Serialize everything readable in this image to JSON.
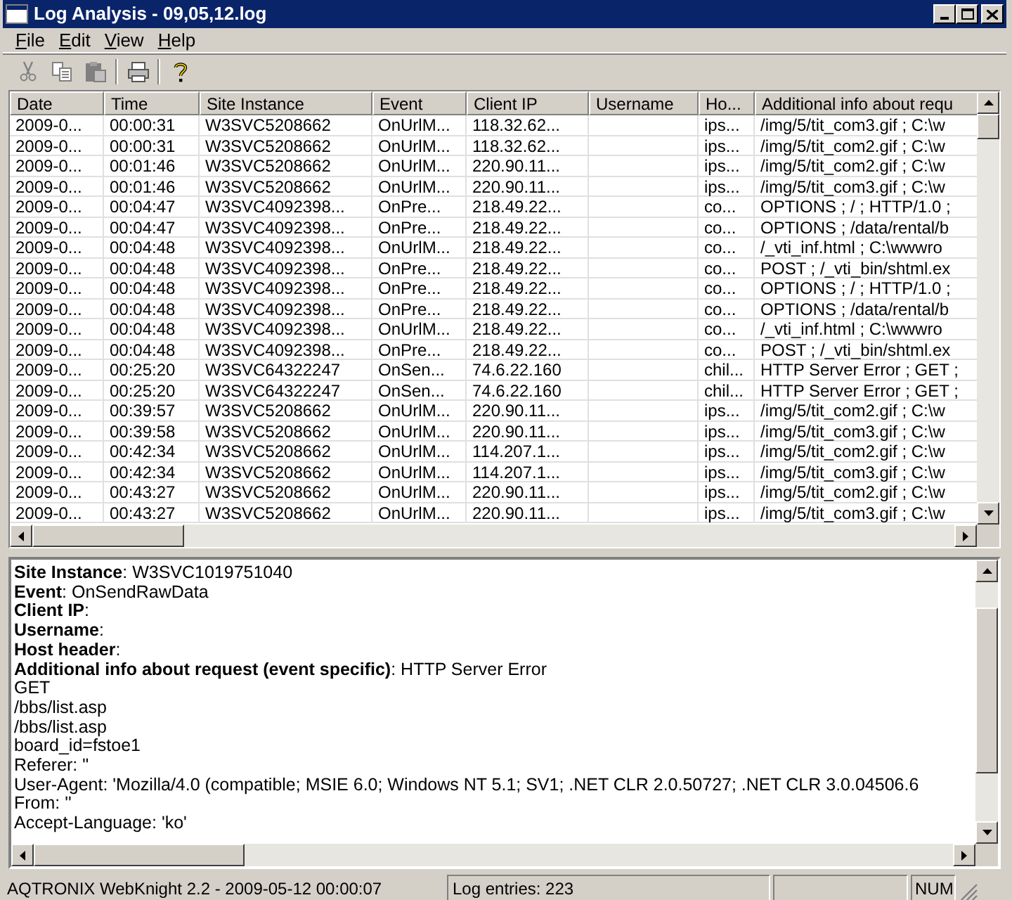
{
  "window": {
    "title": "Log Analysis - 09,05,12.log"
  },
  "menu": [
    "File",
    "Edit",
    "View",
    "Help"
  ],
  "toolbar": [
    {
      "kind": "cut"
    },
    {
      "kind": "copy"
    },
    {
      "kind": "paste"
    },
    {
      "kind": "separator"
    },
    {
      "kind": "print"
    },
    {
      "kind": "separator"
    },
    {
      "kind": "help"
    }
  ],
  "table": {
    "columns": [
      "Date",
      "Time",
      "Site Instance",
      "Event",
      "Client IP",
      "Username",
      "Ho...",
      "Additional info about requ"
    ],
    "rows": [
      {
        "date": "2009-0...",
        "time": "00:00:31",
        "site": "W3SVC5208662",
        "event": "OnUrlM...",
        "client_ip": "118.32.62...",
        "host": "ips...",
        "info": "/img/5/tit_com3.gif ; C:\\w"
      },
      {
        "date": "2009-0...",
        "time": "00:00:31",
        "site": "W3SVC5208662",
        "event": "OnUrlM...",
        "client_ip": "118.32.62...",
        "host": "ips...",
        "info": "/img/5/tit_com2.gif ; C:\\w"
      },
      {
        "date": "2009-0...",
        "time": "00:01:46",
        "site": "W3SVC5208662",
        "event": "OnUrlM...",
        "client_ip": "220.90.11...",
        "host": "ips...",
        "info": "/img/5/tit_com2.gif ; C:\\w"
      },
      {
        "date": "2009-0...",
        "time": "00:01:46",
        "site": "W3SVC5208662",
        "event": "OnUrlM...",
        "client_ip": "220.90.11...",
        "host": "ips...",
        "info": "/img/5/tit_com3.gif ; C:\\w"
      },
      {
        "date": "2009-0...",
        "time": "00:04:47",
        "site": "W3SVC4092398...",
        "event": "OnPre...",
        "client_ip": "218.49.22...",
        "host": "co...",
        "info": "OPTIONS ; / ; HTTP/1.0 ;"
      },
      {
        "date": "2009-0...",
        "time": "00:04:47",
        "site": "W3SVC4092398...",
        "event": "OnPre...",
        "client_ip": "218.49.22...",
        "host": "co...",
        "info": "OPTIONS ; /data/rental/b"
      },
      {
        "date": "2009-0...",
        "time": "00:04:48",
        "site": "W3SVC4092398...",
        "event": "OnUrlM...",
        "client_ip": "218.49.22...",
        "host": "co...",
        "info": "/_vti_inf.html ; C:\\wwwro"
      },
      {
        "date": "2009-0...",
        "time": "00:04:48",
        "site": "W3SVC4092398...",
        "event": "OnPre...",
        "client_ip": "218.49.22...",
        "host": "co...",
        "info": "POST ; /_vti_bin/shtml.ex"
      },
      {
        "date": "2009-0...",
        "time": "00:04:48",
        "site": "W3SVC4092398...",
        "event": "OnPre...",
        "client_ip": "218.49.22...",
        "host": "co...",
        "info": "OPTIONS ; / ; HTTP/1.0 ;"
      },
      {
        "date": "2009-0...",
        "time": "00:04:48",
        "site": "W3SVC4092398...",
        "event": "OnPre...",
        "client_ip": "218.49.22...",
        "host": "co...",
        "info": "OPTIONS ; /data/rental/b"
      },
      {
        "date": "2009-0...",
        "time": "00:04:48",
        "site": "W3SVC4092398...",
        "event": "OnUrlM...",
        "client_ip": "218.49.22...",
        "host": "co...",
        "info": "/_vti_inf.html ; C:\\wwwro"
      },
      {
        "date": "2009-0...",
        "time": "00:04:48",
        "site": "W3SVC4092398...",
        "event": "OnPre...",
        "client_ip": "218.49.22...",
        "host": "co...",
        "info": "POST ; /_vti_bin/shtml.ex"
      },
      {
        "date": "2009-0...",
        "time": "00:25:20",
        "site": "W3SVC64322247",
        "event": "OnSen...",
        "client_ip": "74.6.22.160",
        "host": "chil...",
        "info": "HTTP Server Error ; GET ;"
      },
      {
        "date": "2009-0...",
        "time": "00:25:20",
        "site": "W3SVC64322247",
        "event": "OnSen...",
        "client_ip": "74.6.22.160",
        "host": "chil...",
        "info": "HTTP Server Error ; GET ;"
      },
      {
        "date": "2009-0...",
        "time": "00:39:57",
        "site": "W3SVC5208662",
        "event": "OnUrlM...",
        "client_ip": "220.90.11...",
        "host": "ips...",
        "info": "/img/5/tit_com2.gif ; C:\\w"
      },
      {
        "date": "2009-0...",
        "time": "00:39:58",
        "site": "W3SVC5208662",
        "event": "OnUrlM...",
        "client_ip": "220.90.11...",
        "host": "ips...",
        "info": "/img/5/tit_com3.gif ; C:\\w"
      },
      {
        "date": "2009-0...",
        "time": "00:42:34",
        "site": "W3SVC5208662",
        "event": "OnUrlM...",
        "client_ip": "114.207.1...",
        "host": "ips...",
        "info": "/img/5/tit_com2.gif ; C:\\w"
      },
      {
        "date": "2009-0...",
        "time": "00:42:34",
        "site": "W3SVC5208662",
        "event": "OnUrlM...",
        "client_ip": "114.207.1...",
        "host": "ips...",
        "info": "/img/5/tit_com3.gif ; C:\\w"
      },
      {
        "date": "2009-0...",
        "time": "00:43:27",
        "site": "W3SVC5208662",
        "event": "OnUrlM...",
        "client_ip": "220.90.11...",
        "host": "ips...",
        "info": "/img/5/tit_com2.gif ; C:\\w"
      },
      {
        "date": "2009-0...",
        "time": "00:43:27",
        "site": "W3SVC5208662",
        "event": "OnUrlM...",
        "client_ip": "220.90.11...",
        "host": "ips...",
        "info": "/img/5/tit_com3.gif ; C:\\w"
      }
    ]
  },
  "detail": {
    "lines": [
      "**Site Instance**: W3SVC1019751040",
      "**Event**: OnSendRawData",
      "**Client IP**:",
      "**Username**:",
      "**Host header**:",
      "**Additional info about request (event specific)**: HTTP Server Error",
      "GET",
      "/bbs/list.asp",
      "/bbs/list.asp",
      "board_id=fstoe1",
      "Referer: \"",
      "User-Agent: 'Mozilla/4.0 (compatible; MSIE 6.0; Windows NT 5.1; SV1; .NET CLR 2.0.50727; .NET CLR 3.0.04506.6",
      "From: ''",
      "Accept-Language: 'ko'"
    ]
  },
  "status_bar": {
    "app": "AQTRONIX WebKnight 2.2 - 2009-05-12 00:00:07",
    "entries": "Log entries: 223",
    "num": "NUM"
  }
}
